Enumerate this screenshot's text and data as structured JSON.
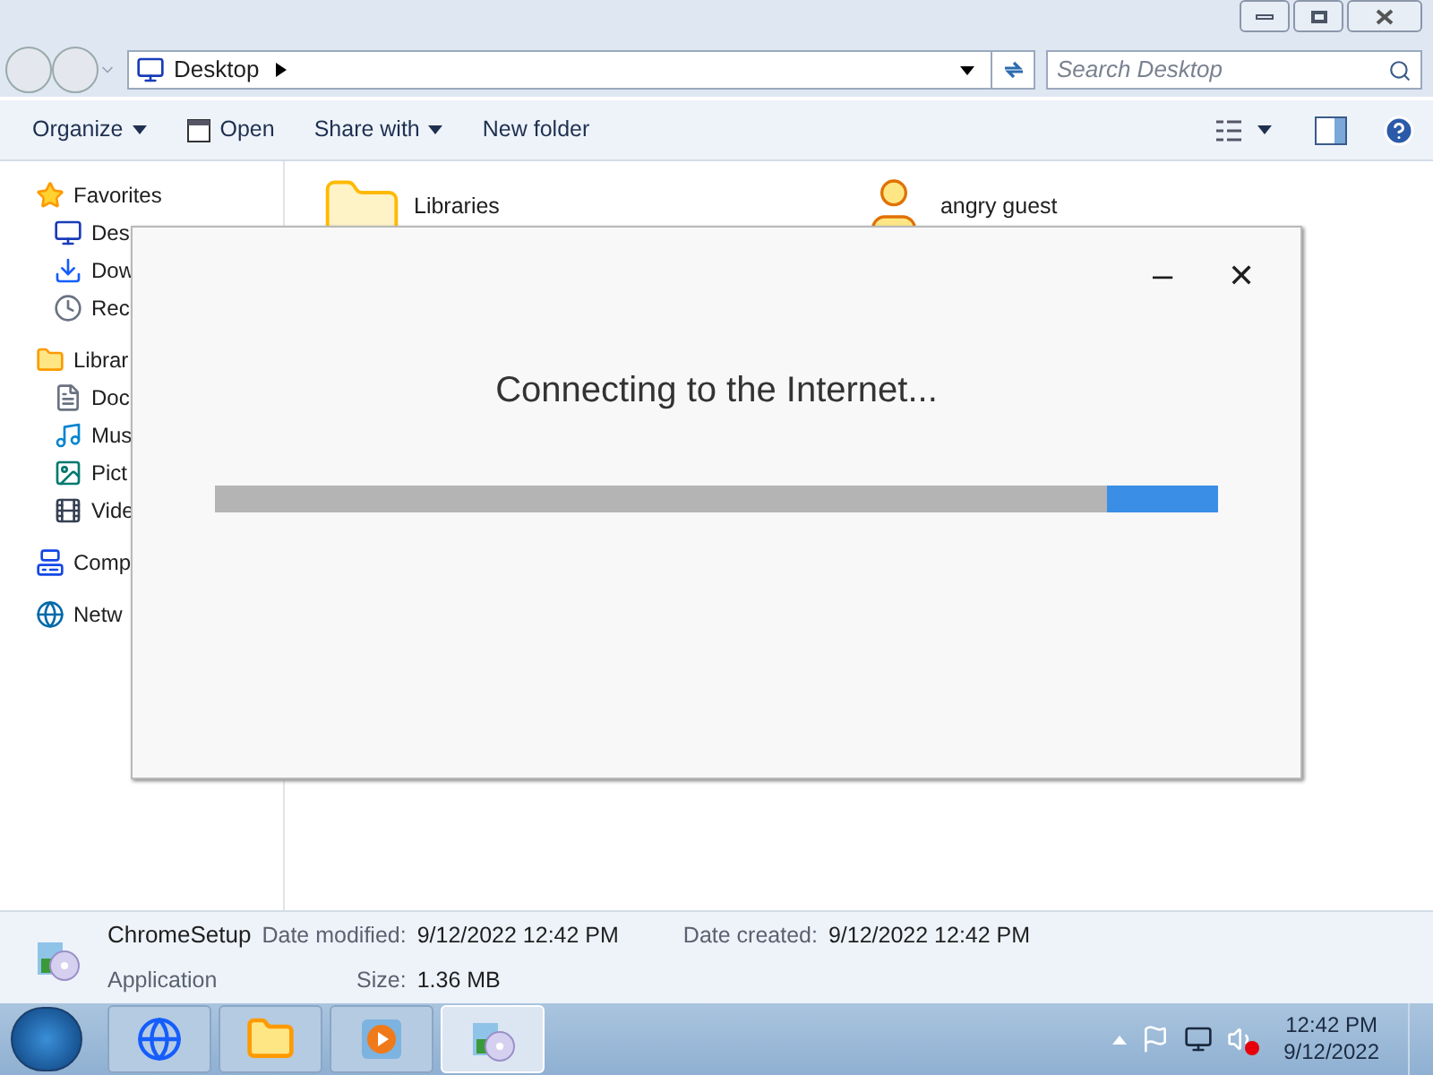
{
  "address_bar": {
    "location": "Desktop"
  },
  "search": {
    "placeholder": "Search Desktop"
  },
  "toolbar": {
    "buttons": [
      {
        "label": "Organize",
        "kind": "menu"
      },
      {
        "label": "Open",
        "kind": "icon"
      },
      {
        "label": "Share with",
        "kind": "menu"
      },
      {
        "label": "New folder",
        "kind": "plain"
      }
    ]
  },
  "sidebar": {
    "groups": [
      {
        "label": "Favorites",
        "children": [
          {
            "label": "Des"
          },
          {
            "label": "Dow"
          },
          {
            "label": "Rec"
          }
        ]
      },
      {
        "label": "Librar",
        "children": [
          {
            "label": "Doc"
          },
          {
            "label": "Mus"
          },
          {
            "label": "Pict"
          },
          {
            "label": "Vide"
          }
        ]
      },
      {
        "label": "Comp"
      },
      {
        "label": "Netw"
      }
    ]
  },
  "items": [
    {
      "name": "Libraries"
    },
    {
      "name": "angry guest"
    }
  ],
  "dialog": {
    "message": "Connecting to the Internet...",
    "minimize": "–",
    "close": "✕",
    "level": 0.11
  },
  "details": {
    "name": "ChromeSetup",
    "type": "Application",
    "fields": [
      {
        "label": "Date modified:",
        "value": "9/12/2022 12:42 PM"
      },
      {
        "label": "Date created:",
        "value": "9/12/2022 12:42 PM"
      },
      {
        "label": "Size:",
        "value": "1.36 MB"
      }
    ]
  },
  "taskbar": {
    "apps": [
      {
        "selected": false
      },
      {
        "selected": false
      },
      {
        "selected": false
      },
      {
        "selected": true
      }
    ],
    "time": "12:42 PM",
    "date": "9/12/2022"
  }
}
